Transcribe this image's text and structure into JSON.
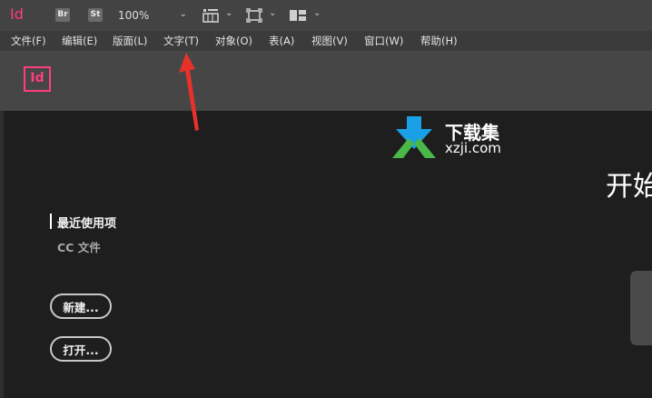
{
  "app": {
    "mark": "Id",
    "logo": "Id"
  },
  "toolbar": {
    "bridge_label": "Br",
    "stock_label": "St",
    "zoom_value": "100%",
    "icons": [
      "frame-grid-icon",
      "screen-mode-icon",
      "workspace-layout-icon"
    ]
  },
  "menu": {
    "items": [
      {
        "label": "文件(F)"
      },
      {
        "label": "编辑(E)"
      },
      {
        "label": "版面(L)"
      },
      {
        "label": "文字(T)"
      },
      {
        "label": "对象(O)"
      },
      {
        "label": "表(A)"
      },
      {
        "label": "视图(V)"
      },
      {
        "label": "窗口(W)"
      },
      {
        "label": "帮助(H)"
      }
    ]
  },
  "watermark": {
    "title": "下载集",
    "site": "xzji.com"
  },
  "start": {
    "heading": "开始",
    "nav": {
      "recent": "最近使用项",
      "cc_files": "CC 文件"
    },
    "buttons": {
      "new": "新建...",
      "open": "打开..."
    }
  },
  "colors": {
    "accent": "#ff3d7f",
    "annotation_arrow": "#e8312a",
    "watermark_blue": "#1aa0e6",
    "watermark_green": "#49b848"
  }
}
